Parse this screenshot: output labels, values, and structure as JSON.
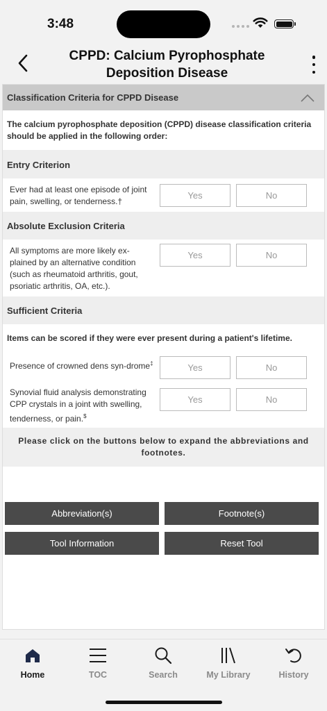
{
  "status": {
    "time": "3:48"
  },
  "nav": {
    "title": "CPPD: Calcium Pyrophosphate Deposition Disease"
  },
  "section": {
    "title": "Classification Criteria for CPPD Disease",
    "intro": "The calcium pyrophosphate deposition (CPPD) disease classification criteria should be applied in the following order:"
  },
  "entry": {
    "header": "Entry Criterion",
    "question": "Ever had at least one episode of joint pain, swelling, or tenderness.†",
    "yes": "Yes",
    "no": "No"
  },
  "exclusion": {
    "header": "Absolute Exclusion Criteria",
    "question": "All symptoms are more likely ex-plained by an alternative condition (such as rheumatoid arthritis, gout, psoriatic arthritis, OA, etc.).",
    "yes": "Yes",
    "no": "No"
  },
  "sufficient": {
    "header": "Sufficient Criteria",
    "note": "Items can be scored if they were ever present during a patient's lifetime.",
    "q1_text": "Presence of crowned dens syn-drome",
    "q1_sup": "‡",
    "q2_text": "Synovial fluid analysis demonstrating CPP crystals in a joint with swelling, tenderness, or pain.",
    "q2_sup": "$",
    "yes": "Yes",
    "no": "No"
  },
  "click_note": "Please click on the buttons below to expand the abbreviations and footnotes.",
  "buttons": {
    "abbreviations": "Abbreviation(s)",
    "footnotes": "Footnote(s)",
    "tool_info": "Tool Information",
    "reset": "Reset Tool"
  },
  "tabs": [
    {
      "label": "Home",
      "icon": "home-icon"
    },
    {
      "label": "TOC",
      "icon": "list-icon"
    },
    {
      "label": "Search",
      "icon": "search-icon"
    },
    {
      "label": "My Library",
      "icon": "library-icon"
    },
    {
      "label": "History",
      "icon": "history-icon"
    }
  ],
  "colors": {
    "header_gray": "#c9c9c9",
    "button_dark": "#4a4a4a",
    "row_gray": "#eeeeee"
  }
}
